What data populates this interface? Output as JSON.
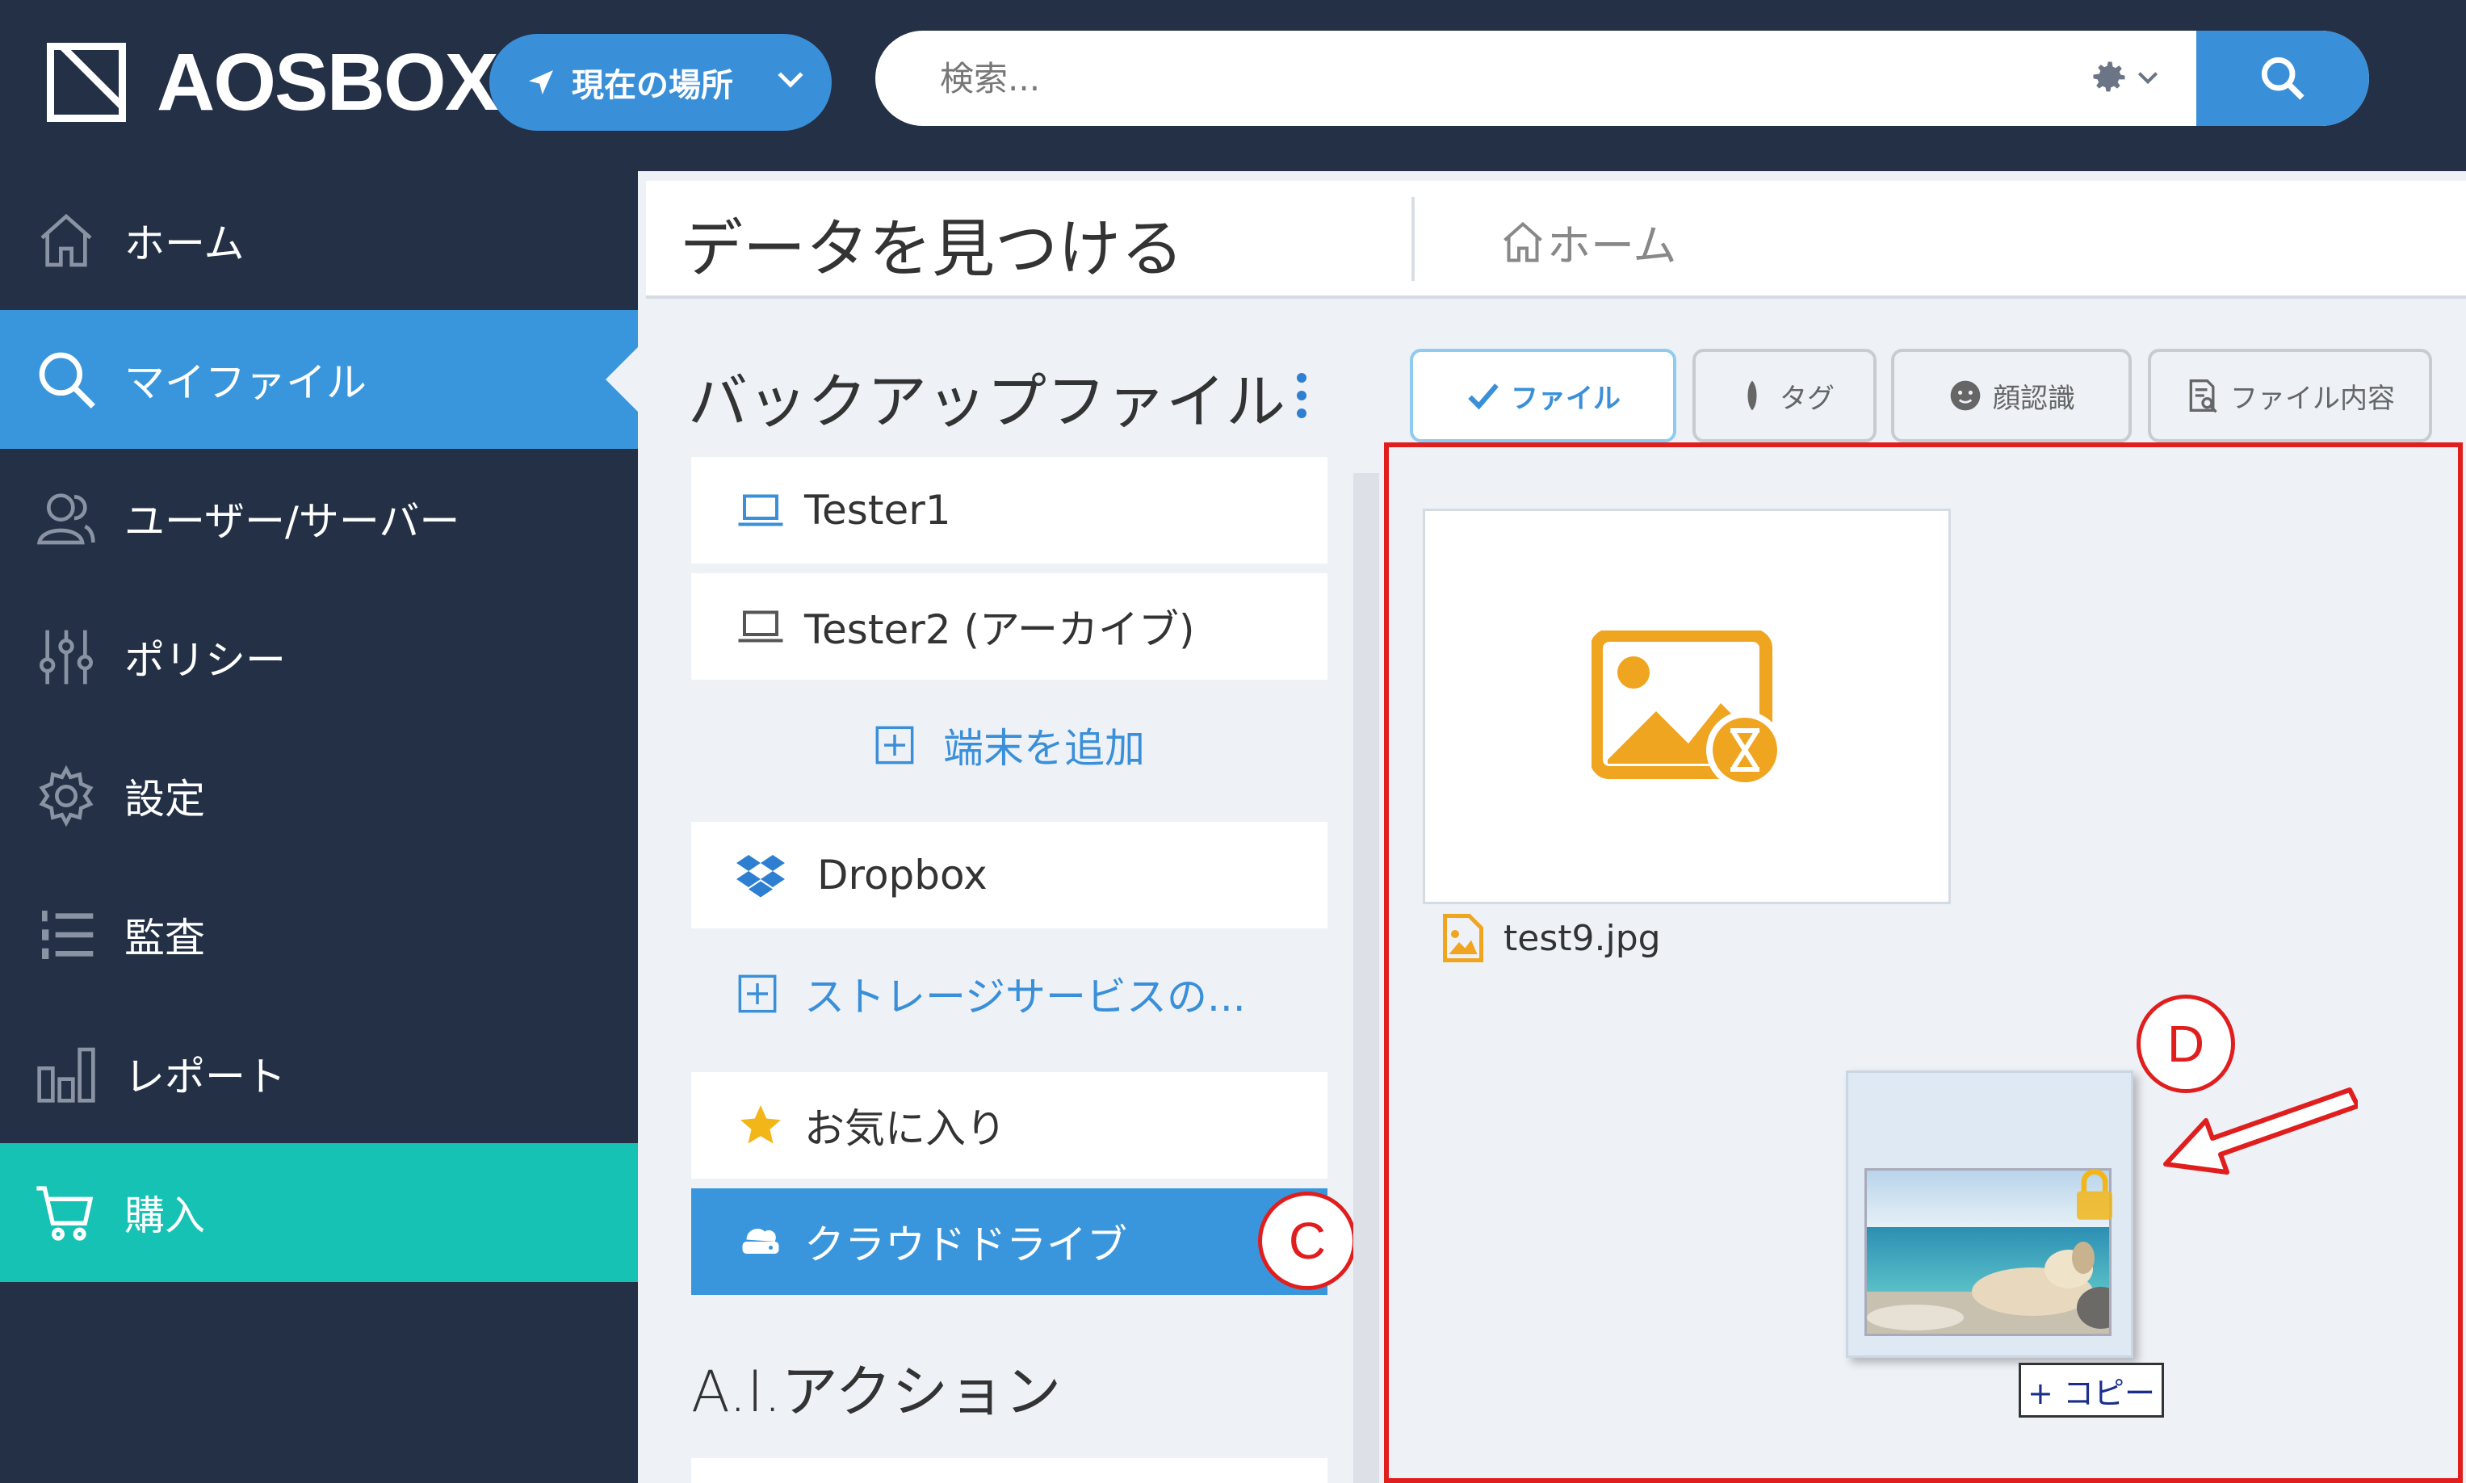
{
  "brand": {
    "logo_text": "AOSBOX"
  },
  "location_button": {
    "label": "現在の場所"
  },
  "search": {
    "placeholder": "検索..."
  },
  "sidebar": {
    "items": [
      {
        "label": "ホーム"
      },
      {
        "label": "マイファイル"
      },
      {
        "label": "ユーザー/サーバー"
      },
      {
        "label": "ポリシー"
      },
      {
        "label": "設定"
      },
      {
        "label": "監査"
      },
      {
        "label": "レポート"
      },
      {
        "label": "購入"
      }
    ]
  },
  "header": {
    "title": "データを見つける",
    "breadcrumb": "ホーム"
  },
  "backup": {
    "title": "バックアップファイル",
    "devices": [
      "Tester1",
      "Tester2 (アーカイブ)"
    ],
    "add_device": "端末を追加",
    "storage": [
      "Dropbox"
    ],
    "add_storage": "ストレージサービスの...",
    "favorites": "お気に入り",
    "cloud_drive": "クラウドドライブ"
  },
  "ai": {
    "title": "A.I.アクション"
  },
  "tabs": [
    {
      "label": "ファイル"
    },
    {
      "label": "タグ"
    },
    {
      "label": "顔認識"
    },
    {
      "label": "ファイル内容"
    }
  ],
  "files": [
    {
      "name": "test9.jpg"
    }
  ],
  "drag": {
    "copy_label": "+ コピー"
  },
  "callouts": {
    "c": "C",
    "d": "D"
  },
  "colors": {
    "navy": "#233045",
    "accent": "#3a96dc",
    "buy": "#16c2b4",
    "annotation": "#e01e1e",
    "file_icon": "#f0a521"
  }
}
